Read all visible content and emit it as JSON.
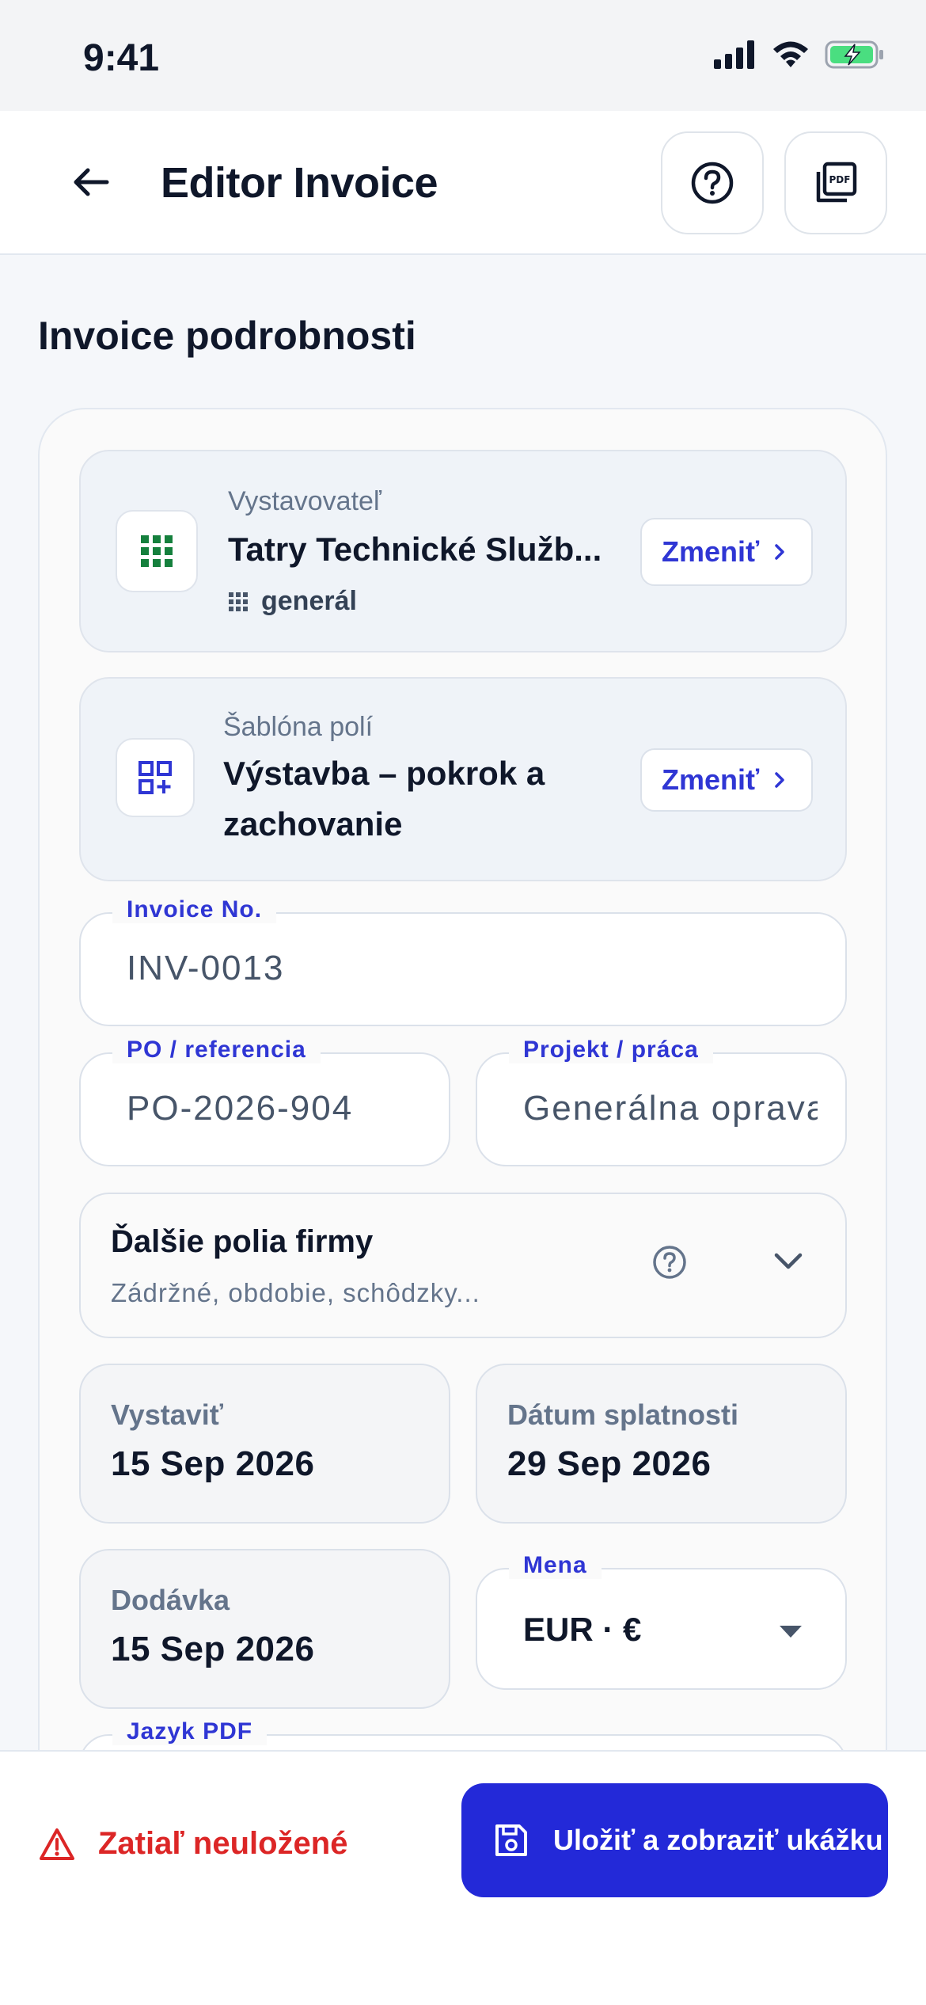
{
  "status_bar": {
    "time": "9:41"
  },
  "header": {
    "title": "Editor Invoice"
  },
  "section": {
    "title": "Invoice podrobnosti"
  },
  "issuer": {
    "label": "Vystavovateľ",
    "name": "Tatry Technické Služb...",
    "tag": "generál",
    "change_label": "Zmeniť"
  },
  "template": {
    "label": "Šablóna polí",
    "name_line1": "Výstavba – pokrok a",
    "name_line2": "zachovanie",
    "change_label": "Zmeniť"
  },
  "fields": {
    "invoice_no": {
      "label": "Invoice No.",
      "value": "INV-0013"
    },
    "po_reference": {
      "label": "PO / referencia",
      "value": "PO-2026-904"
    },
    "project": {
      "label": "Projekt / práca",
      "value": "Generálna oprava"
    }
  },
  "more_fields": {
    "title": "Ďalšie polia firmy",
    "subtitle": "Zádržné, obdobie, schôdzky..."
  },
  "dates": {
    "issue": {
      "label": "Vystaviť",
      "value": "15 Sep 2026"
    },
    "due": {
      "label": "Dátum splatnosti",
      "value": "29 Sep 2026"
    },
    "delivery": {
      "label": "Dodávka",
      "value": "15 Sep 2026"
    }
  },
  "currency": {
    "label": "Mena",
    "value": "EUR · €"
  },
  "pdf_language": {
    "label": "Jazyk PDF"
  },
  "bottom": {
    "unsaved": "Zatiaľ neuložené",
    "save_label": "Uložiť a zobraziť ukážku"
  },
  "colors": {
    "accent": "#2329d8",
    "link": "#2f36d4",
    "warning": "#dc2626",
    "grid_green": "#15803d"
  }
}
